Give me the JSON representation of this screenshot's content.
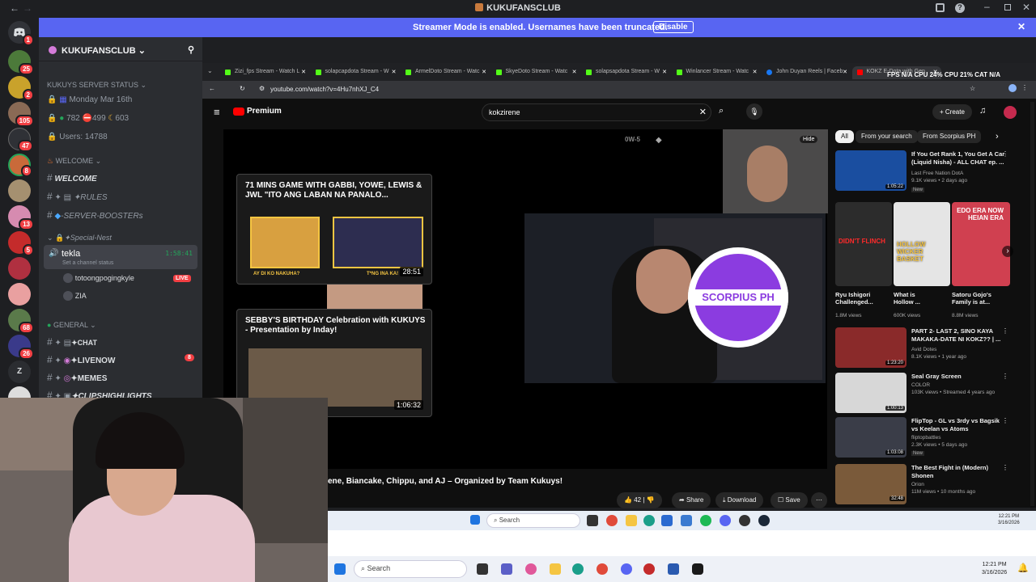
{
  "window": {
    "title": "KUKUFANSCLUB"
  },
  "streamer_banner": {
    "message": "Streamer Mode is enabled. Usernames have been truncated.",
    "disable_label": "Disable"
  },
  "guild_badges": [
    "1",
    "25",
    "2",
    "105",
    "47",
    "8",
    "13",
    "5",
    "68",
    "26"
  ],
  "server": {
    "name": "KUKUFANSCLUB",
    "status_header": "KUKUYS SERVER STATUS",
    "date": "Monday Mar 16th",
    "online": "782",
    "dnd": "499",
    "idle": "603",
    "users": "Users: 14788",
    "welcome_cat": "WELCOME",
    "ch_welcome": "WELCOME",
    "ch_rules": "✦RULES",
    "ch_boosters": "-SERVER-BOOSTERs",
    "special_cat": "✦Special-Nest",
    "voice_name": "tekla",
    "voice_time": "1:58:41",
    "voice_status": "Set a channel status",
    "voice_user1": "totoongpogingkyle",
    "live_badge": "LIVE",
    "voice_user2": "ZIA",
    "general_cat": "GENERAL",
    "ch_chat": "✦CHAT",
    "ch_livenow": "✦LIVENOW",
    "livenow_count": "8",
    "ch_memes": "✦MEMES",
    "ch_clips": "✦CLIPSHIGHLIGHTS"
  },
  "browser": {
    "tabs": [
      "Zizi_fps Stream - Watch L",
      "solapcapdota Stream - W",
      "ArmelDoto Stream - Watc",
      "SkyeDoto Stream - Watc",
      "solapsapdota Stream - W",
      "Winlancer Stream - Watc",
      "John Duyan Reels | Faceb",
      "KOKZ E-Dota with Gen"
    ],
    "url": "youtube.com/watch?v=4Hu7nhXJ_C4",
    "stats": "FPS N/A   CPU 24%   CPU 21%   CAT N/A"
  },
  "youtube": {
    "logo": "Premium",
    "query": "kokzirene",
    "create": "Create",
    "chips": [
      "All",
      "From your search",
      "From Scorpius PH"
    ],
    "hide": "Hide",
    "overlay_text": "0W-5",
    "logo_text": "SCORPIUS PH",
    "video_title": "ene, Biancake, Chippu, and AJ – Organized by Team Kukuys!",
    "like_count": "42",
    "share": "Share",
    "download": "Download",
    "save": "Save",
    "card1_title": "71 MINS GAME WITH GABBI, YOWE, LEWIS & JWL \"ITO ANG LABAN NA PANALO...",
    "card1_dur": "28:51",
    "card1_caption": "T*NG INA KA!",
    "card1_caption2": "AY DI KO NAKUHA?",
    "card2_title": "SEBBY'S BIRTHDAY Celebration with KUKUYS - Presentation by Inday!",
    "card2_dur": "1:06:32"
  },
  "recommendations": [
    {
      "title": "If You Get Rank 1, You Get A Car (Liquid Nisha) - ALL CHAT ep. ...",
      "channel": "Last Free Nation DotA",
      "meta": "9.1K views • 2 days ago",
      "badge": "New",
      "dur": "1:05:22"
    },
    {
      "title": "PART 2- LAST 2, SINO KAYA MAKAKA-DATE NI KOKZ?? | ...",
      "channel": "Avid Dotes",
      "meta": "8.1K views • 1 year ago",
      "dur": "1:23:20"
    },
    {
      "title": "Seal Gray Screen",
      "channel": "COLOR",
      "meta": "103K views • Streamed 4 years ago",
      "dur": "1:00:13"
    },
    {
      "title": "FlipTop - GL vs 3rdy vs Bagsik vs Keelan vs Atoms",
      "channel": "fliptopbattles",
      "meta": "2.3K views • 5 days ago",
      "badge": "New",
      "dur": "1:03:08"
    },
    {
      "title": "The Best Fight in (Modern) Shonen",
      "channel": "Orion",
      "meta": "11M views • 10 months ago",
      "dur": "32:48"
    }
  ],
  "shorts": [
    {
      "title": "Ryu Ishigori Challenged...",
      "views": "1.8M views",
      "label": "DIDN'T FLINCH"
    },
    {
      "title": "What is Hollow ...",
      "views": "600K views",
      "label": "HOLLOW WICKER BASKET"
    },
    {
      "title": "Satoru Gojo's Family is at...",
      "views": "8.8M views",
      "label": "EDO ERA NOW HEIAN ERA"
    }
  ],
  "taskbar": {
    "search": "Search",
    "time": "12:21 PM",
    "date": "3/16/2026"
  },
  "taskbar2": {
    "search": "Search",
    "time": "12:21 PM",
    "date": "3/16/2026"
  },
  "colors": {
    "discord_bg": "#1e1f22",
    "blurple": "#5865f2",
    "yt_red": "#ff0000",
    "live": "#f23f43"
  }
}
